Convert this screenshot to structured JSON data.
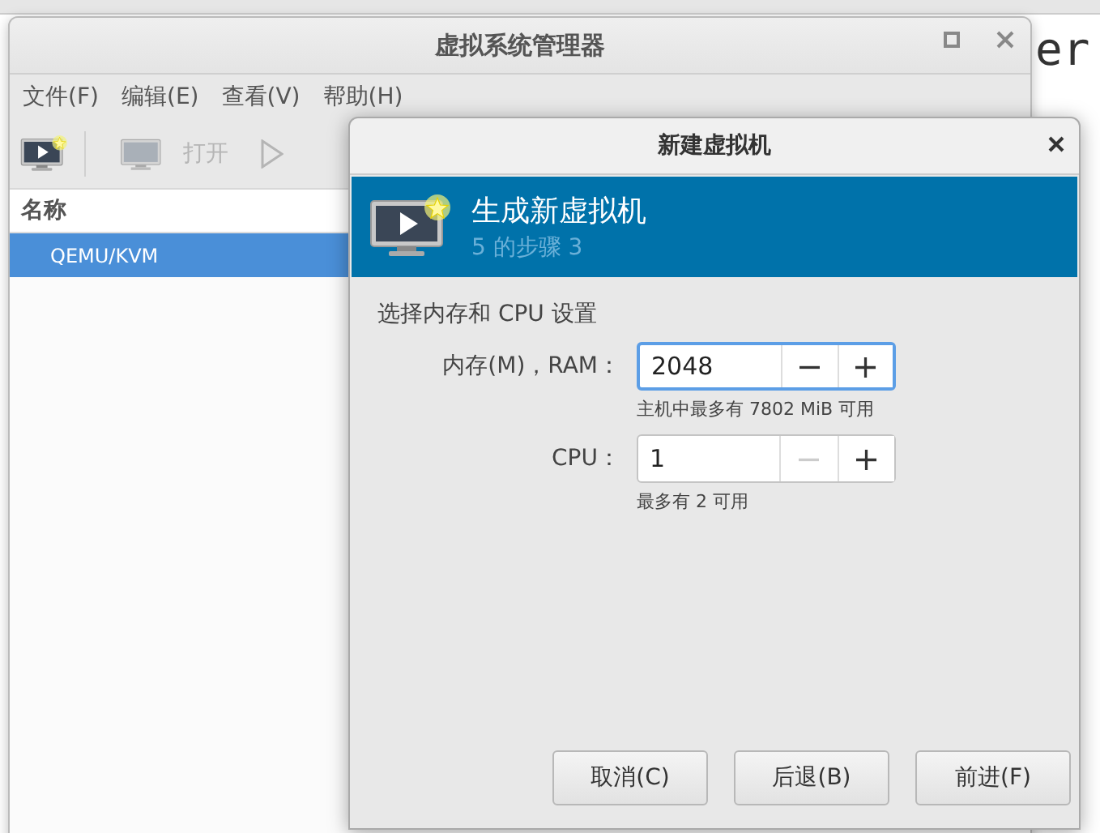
{
  "desktop": {
    "terminal_text": "er"
  },
  "main_window": {
    "title": "虚拟系统管理器",
    "menu": [
      "文件(F)",
      "编辑(E)",
      "查看(V)",
      "帮助(H)"
    ],
    "toolbar": [
      {
        "kind": "new",
        "disabled": false
      },
      {
        "kind": "open",
        "label": "打开",
        "disabled": true
      },
      {
        "kind": "run",
        "disabled": true
      }
    ],
    "list": {
      "header": "名称",
      "rows": [
        {
          "label": "QEMU/KVM",
          "selected": true
        }
      ]
    }
  },
  "dialog": {
    "title": "新建虚拟机",
    "banner_title": "生成新虚拟机",
    "banner_step": "5 的步骤 3",
    "section": "选择内存和 CPU 设置",
    "spinners": [
      {
        "label": "内存(M)，RAM：",
        "value": "2048",
        "focused": true,
        "decrement_disabled": false,
        "decrement": "−",
        "increment": "+",
        "hint": "主机中最多有 7802 MiB 可用"
      },
      {
        "label": "CPU：",
        "value": "1",
        "focused": false,
        "decrement_disabled": true,
        "decrement": "−",
        "increment": "+",
        "hint": "最多有 2 可用"
      }
    ],
    "buttons": [
      "取消(C)",
      "后退(B)",
      "前进(F)"
    ]
  }
}
